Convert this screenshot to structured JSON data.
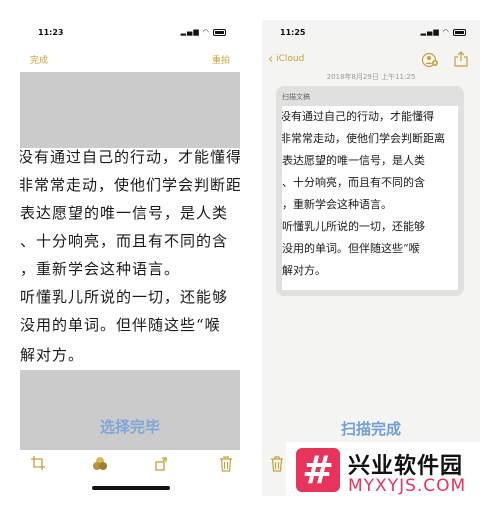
{
  "left_screen": {
    "status_time": "11:23",
    "done_label": "完成",
    "retake_label": "重拍",
    "scan_lines": [
      "没有通过自己的行动，才能懂得",
      "非常常走动，使他们学会判断距离",
      "表达愿望的唯一信号，是人类",
      "、十分响亮，而且有不同的含",
      "，重新学会这种语言。",
      "听懂乳儿所说的一切，还能够",
      "没用的单词。但伴随这些“喉",
      "解对方。"
    ],
    "select_done_label": "选择完毕"
  },
  "right_screen": {
    "status_time": "11:25",
    "back_label": "iCloud",
    "note_date": "2018年8月29日 上午11:25",
    "card_label": "扫描文稿",
    "scan_lines": [
      "没有通过自己的行动，才能懂得",
      "非常常走动，使他们学会判断距离",
      "表达愿望的唯一信号，是人类",
      "、十分响亮，而且有不同的含",
      "，重新学会这种语言。",
      "听懂乳儿所说的一切，还能够",
      "没用的单词。但伴随这些“喉",
      "解对方。"
    ],
    "scan_complete_label": "扫描完成"
  },
  "watermark": {
    "logo_char": "#",
    "name": "兴业软件园",
    "url": "MYXYJS.COM"
  },
  "colors": {
    "accent": "#c8a03a",
    "done_text": "#7ea6d8",
    "brand": "#e8335a",
    "grey_mask": "#cbcbcb"
  }
}
